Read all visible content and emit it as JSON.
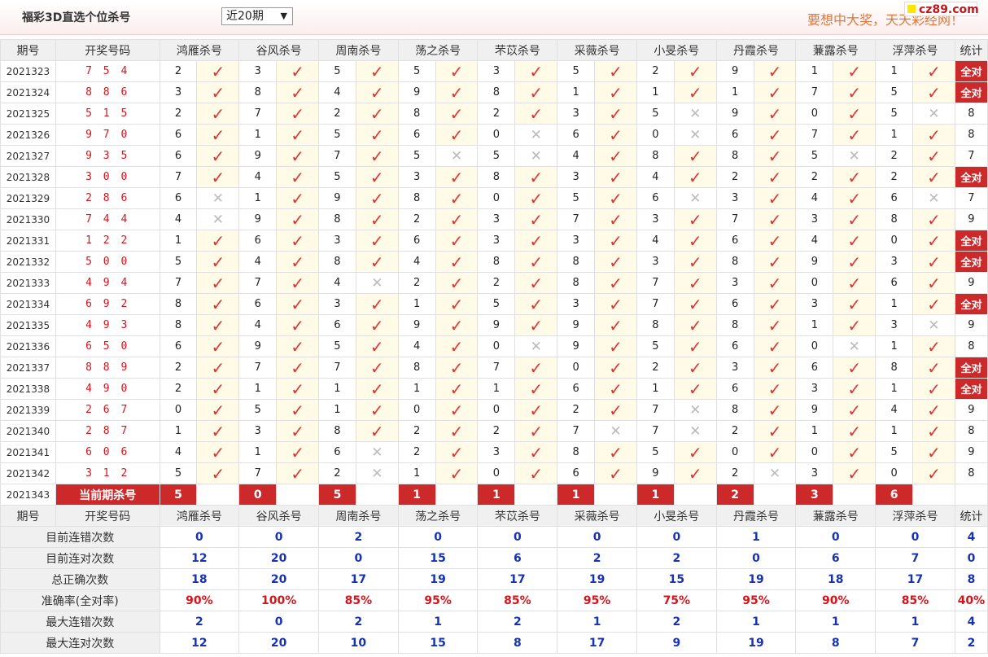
{
  "header": {
    "title": "福彩3D直选个位杀号",
    "range_select": "近20期",
    "slogan": "要想中大奖，天天彩经网！",
    "logo": "cz89.com"
  },
  "columns": {
    "period": "期号",
    "winning": "开奖号码",
    "experts": [
      "鸿雁杀号",
      "谷风杀号",
      "周南杀号",
      "荡之杀号",
      "芣苡杀号",
      "采薇杀号",
      "小旻杀号",
      "丹霞杀号",
      "蒹露杀号",
      "浮萍杀号"
    ],
    "stat": "统计"
  },
  "rows": [
    {
      "period": "2021323",
      "winning": "7 5 4",
      "kills": [
        2,
        3,
        5,
        5,
        3,
        5,
        2,
        9,
        1,
        1
      ],
      "hits": [
        1,
        1,
        1,
        1,
        1,
        1,
        1,
        1,
        1,
        1
      ],
      "stat": "全对"
    },
    {
      "period": "2021324",
      "winning": "8 8 6",
      "kills": [
        3,
        8,
        4,
        9,
        8,
        1,
        1,
        1,
        7,
        5
      ],
      "hits": [
        1,
        1,
        1,
        1,
        1,
        1,
        1,
        1,
        1,
        1
      ],
      "stat": "全对"
    },
    {
      "period": "2021325",
      "winning": "5 1 5",
      "kills": [
        2,
        7,
        2,
        8,
        2,
        3,
        5,
        9,
        0,
        5
      ],
      "hits": [
        1,
        1,
        1,
        1,
        1,
        1,
        0,
        1,
        1,
        0
      ],
      "stat": "8"
    },
    {
      "period": "2021326",
      "winning": "9 7 0",
      "kills": [
        6,
        1,
        5,
        6,
        0,
        6,
        0,
        6,
        7,
        1
      ],
      "hits": [
        1,
        1,
        1,
        1,
        0,
        1,
        0,
        1,
        1,
        1
      ],
      "stat": "8"
    },
    {
      "period": "2021327",
      "winning": "9 3 5",
      "kills": [
        6,
        9,
        7,
        5,
        5,
        4,
        8,
        8,
        5,
        2
      ],
      "hits": [
        1,
        1,
        1,
        0,
        0,
        1,
        1,
        1,
        0,
        1
      ],
      "stat": "7"
    },
    {
      "period": "2021328",
      "winning": "3 0 0",
      "kills": [
        7,
        4,
        5,
        3,
        8,
        3,
        4,
        2,
        2,
        2
      ],
      "hits": [
        1,
        1,
        1,
        1,
        1,
        1,
        1,
        1,
        1,
        1
      ],
      "stat": "全对"
    },
    {
      "period": "2021329",
      "winning": "2 8 6",
      "kills": [
        6,
        1,
        9,
        8,
        0,
        5,
        6,
        3,
        4,
        6
      ],
      "hits": [
        0,
        1,
        1,
        1,
        1,
        1,
        0,
        1,
        1,
        0
      ],
      "stat": "7"
    },
    {
      "period": "2021330",
      "winning": "7 4 4",
      "kills": [
        4,
        9,
        8,
        2,
        3,
        7,
        3,
        7,
        3,
        8
      ],
      "hits": [
        0,
        1,
        1,
        1,
        1,
        1,
        1,
        1,
        1,
        1
      ],
      "stat": "9"
    },
    {
      "period": "2021331",
      "winning": "1 2 2",
      "kills": [
        1,
        6,
        3,
        6,
        3,
        3,
        4,
        6,
        4,
        0
      ],
      "hits": [
        1,
        1,
        1,
        1,
        1,
        1,
        1,
        1,
        1,
        1
      ],
      "stat": "全对"
    },
    {
      "period": "2021332",
      "winning": "5 0 0",
      "kills": [
        5,
        4,
        8,
        4,
        8,
        8,
        3,
        8,
        9,
        3
      ],
      "hits": [
        1,
        1,
        1,
        1,
        1,
        1,
        1,
        1,
        1,
        1
      ],
      "stat": "全对"
    },
    {
      "period": "2021333",
      "winning": "4 9 4",
      "kills": [
        7,
        7,
        4,
        2,
        2,
        8,
        7,
        3,
        0,
        6
      ],
      "hits": [
        1,
        1,
        0,
        1,
        1,
        1,
        1,
        1,
        1,
        1
      ],
      "stat": "9"
    },
    {
      "period": "2021334",
      "winning": "6 9 2",
      "kills": [
        8,
        6,
        3,
        1,
        5,
        3,
        7,
        6,
        3,
        1
      ],
      "hits": [
        1,
        1,
        1,
        1,
        1,
        1,
        1,
        1,
        1,
        1
      ],
      "stat": "全对"
    },
    {
      "period": "2021335",
      "winning": "4 9 3",
      "kills": [
        8,
        4,
        6,
        9,
        9,
        9,
        8,
        8,
        1,
        3
      ],
      "hits": [
        1,
        1,
        1,
        1,
        1,
        1,
        1,
        1,
        1,
        0
      ],
      "stat": "9"
    },
    {
      "period": "2021336",
      "winning": "6 5 0",
      "kills": [
        6,
        9,
        5,
        4,
        0,
        9,
        5,
        6,
        0,
        1
      ],
      "hits": [
        1,
        1,
        1,
        1,
        0,
        1,
        1,
        1,
        0,
        1
      ],
      "stat": "8"
    },
    {
      "period": "2021337",
      "winning": "8 8 9",
      "kills": [
        2,
        7,
        7,
        8,
        7,
        0,
        2,
        3,
        6,
        8
      ],
      "hits": [
        1,
        1,
        1,
        1,
        1,
        1,
        1,
        1,
        1,
        1
      ],
      "stat": "全对"
    },
    {
      "period": "2021338",
      "winning": "4 9 0",
      "kills": [
        2,
        1,
        1,
        1,
        1,
        6,
        1,
        6,
        3,
        1
      ],
      "hits": [
        1,
        1,
        1,
        1,
        1,
        1,
        1,
        1,
        1,
        1
      ],
      "stat": "全对"
    },
    {
      "period": "2021339",
      "winning": "2 6 7",
      "kills": [
        0,
        5,
        1,
        0,
        0,
        2,
        7,
        8,
        9,
        4
      ],
      "hits": [
        1,
        1,
        1,
        1,
        1,
        1,
        0,
        1,
        1,
        1
      ],
      "stat": "9"
    },
    {
      "period": "2021340",
      "winning": "2 8 7",
      "kills": [
        1,
        3,
        8,
        2,
        2,
        7,
        7,
        2,
        1,
        1
      ],
      "hits": [
        1,
        1,
        1,
        1,
        1,
        0,
        0,
        1,
        1,
        1
      ],
      "stat": "8"
    },
    {
      "period": "2021341",
      "winning": "6 0 6",
      "kills": [
        4,
        1,
        6,
        2,
        3,
        8,
        5,
        0,
        0,
        5
      ],
      "hits": [
        1,
        1,
        0,
        1,
        1,
        1,
        1,
        1,
        1,
        1
      ],
      "stat": "9"
    },
    {
      "period": "2021342",
      "winning": "3 1 2",
      "kills": [
        5,
        7,
        2,
        1,
        0,
        6,
        9,
        2,
        3,
        0
      ],
      "hits": [
        1,
        1,
        0,
        1,
        1,
        1,
        1,
        0,
        1,
        1
      ],
      "stat": "8"
    }
  ],
  "current": {
    "period": "2021343",
    "label": "当前期杀号",
    "kills": [
      5,
      0,
      5,
      1,
      1,
      1,
      1,
      2,
      3,
      6
    ]
  },
  "summary": {
    "header_period": "期号",
    "header_winning": "开奖号码",
    "rows": [
      {
        "label": "目前连错次数",
        "values": [
          "0",
          "0",
          "2",
          "0",
          "0",
          "0",
          "0",
          "1",
          "0",
          "0"
        ],
        "stat": "4",
        "kind": "sum"
      },
      {
        "label": "目前连对次数",
        "values": [
          "12",
          "20",
          "0",
          "15",
          "6",
          "2",
          "2",
          "0",
          "6",
          "7"
        ],
        "stat": "0",
        "kind": "sum"
      },
      {
        "label": "总正确次数",
        "values": [
          "18",
          "20",
          "17",
          "19",
          "17",
          "19",
          "15",
          "19",
          "18",
          "17"
        ],
        "stat": "8",
        "kind": "sum"
      },
      {
        "label": "准确率(全对率)",
        "values": [
          "90%",
          "100%",
          "85%",
          "95%",
          "85%",
          "95%",
          "75%",
          "95%",
          "90%",
          "85%"
        ],
        "stat": "40%",
        "kind": "pct"
      },
      {
        "label": "最大连错次数",
        "values": [
          "2",
          "0",
          "2",
          "1",
          "2",
          "1",
          "2",
          "1",
          "1",
          "1"
        ],
        "stat": "4",
        "kind": "sum"
      },
      {
        "label": "最大连对次数",
        "values": [
          "12",
          "20",
          "10",
          "15",
          "8",
          "17",
          "9",
          "19",
          "8",
          "7"
        ],
        "stat": "2",
        "kind": "sum"
      }
    ]
  },
  "icons": {
    "hit": "check-icon",
    "miss": "cross-icon"
  },
  "colors": {
    "accent": "#cc2a2a",
    "check": "#e13333",
    "summary_blue": "#1733b0",
    "percent_red": "#d7141c",
    "slogan": "#e3763c"
  }
}
